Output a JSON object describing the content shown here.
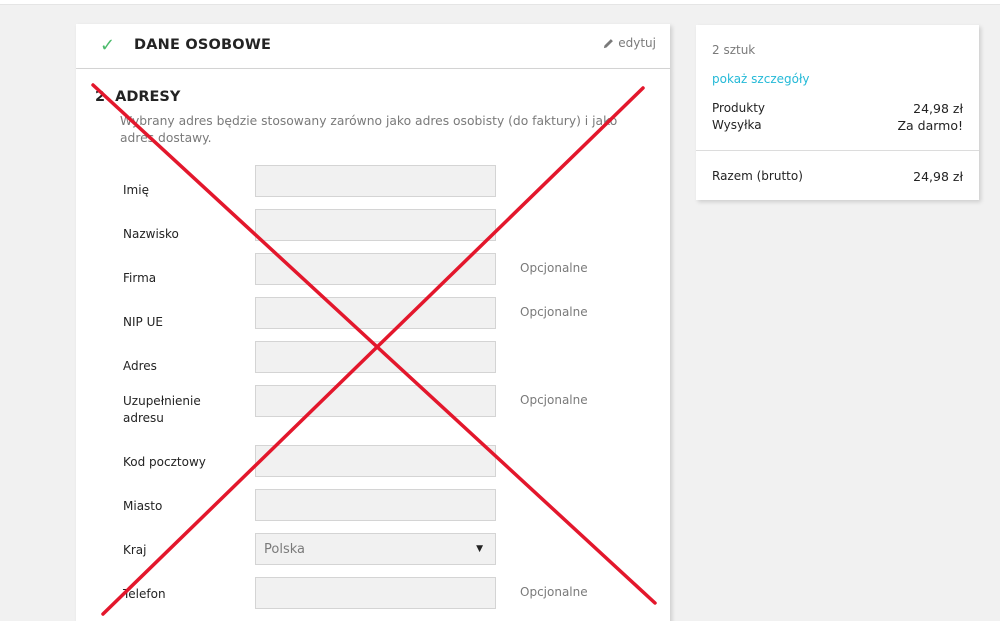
{
  "personal": {
    "check_icon": "checkmark-icon",
    "title": "DANE OSOBOWE",
    "edit_label": "edytuj"
  },
  "addresses": {
    "number": "2",
    "title": "ADRESY",
    "intro": "Wybrany adres będzie stosowany zarówno jako adres osobisty (do faktury) i jako adres dostawy.",
    "fields": [
      {
        "label": "Imię",
        "value": "",
        "optional": ""
      },
      {
        "label": "Nazwisko",
        "value": "",
        "optional": ""
      },
      {
        "label": "Firma",
        "value": "",
        "optional": "Opcjonalne"
      },
      {
        "label": "NIP UE",
        "value": "",
        "optional": "Opcjonalne"
      },
      {
        "label": "Adres",
        "value": "",
        "optional": ""
      },
      {
        "label": "Uzupełnienie adresu",
        "value": "",
        "optional": "Opcjonalne"
      },
      {
        "label": "Kod pocztowy",
        "value": "",
        "optional": ""
      },
      {
        "label": "Miasto",
        "value": "",
        "optional": ""
      },
      {
        "label": "Kraj",
        "value": "Polska",
        "optional": ""
      },
      {
        "label": "Telefon",
        "value": "",
        "optional": "Opcjonalne"
      }
    ]
  },
  "summary": {
    "items_count": "2 sztuk",
    "details_link": "pokaż szczegóły",
    "products_label": "Produkty",
    "products_value": "24,98 zł",
    "shipping_label": "Wysyłka",
    "shipping_value": "Za darmo!",
    "total_label": "Razem (brutto)",
    "total_value": "24,98 zł"
  },
  "colors": {
    "accent_link": "#24b9d7",
    "check": "#4cbb6c",
    "cross": "#e3172c"
  }
}
